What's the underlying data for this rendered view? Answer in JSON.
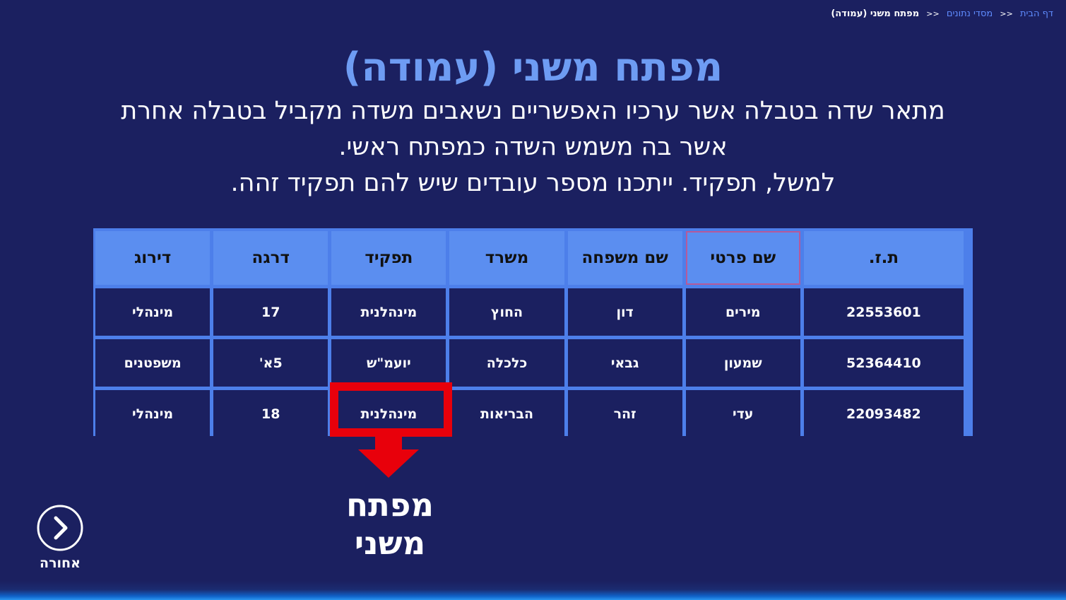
{
  "breadcrumb": {
    "home": "דף הבית",
    "parent": "מסדי נתונים",
    "separator": "<<",
    "current": "מפתח משני (עמודה)"
  },
  "title": "מפתח משני (עמודה)",
  "description": {
    "line1": "מתאר שדה בטבלה אשר ערכיו האפשריים נשאבים משדה מקביל בטבלה אחרת",
    "line2": "אשר בה משמש השדה כמפתח ראשי.",
    "line3": "למשל, תפקיד. ייתכנו מספר עובדים שיש להם תפקיד זהה."
  },
  "table": {
    "headers": [
      "ת.ז.",
      "שם פרטי",
      "שם משפחה",
      "משרד",
      "תפקיד",
      "דרגה",
      "דירוג"
    ],
    "rows": [
      [
        "22553601",
        "מירים",
        "דון",
        "החוץ",
        "מינהלנית",
        "17",
        "מינהלי"
      ],
      [
        "52364410",
        "שמעון",
        "גבאי",
        "כלכלה",
        "יועמ\"ש",
        "5א'",
        "משפטנים"
      ],
      [
        "22093482",
        "עדי",
        "זהר",
        "הבריאות",
        "מינהלנית",
        "18",
        "מינהלי"
      ]
    ]
  },
  "annotation": {
    "line1": "מפתח",
    "line2": "משני"
  },
  "navigation": {
    "back_label": "אחורה",
    "back_icon": "chevron-right-icon"
  },
  "colors": {
    "background": "#1b2060",
    "title": "#6e9cf3",
    "header_fill": "#5b8ef0",
    "table_border": "#4d7fea",
    "highlight": "#e8000b",
    "link": "#5f8cff"
  }
}
